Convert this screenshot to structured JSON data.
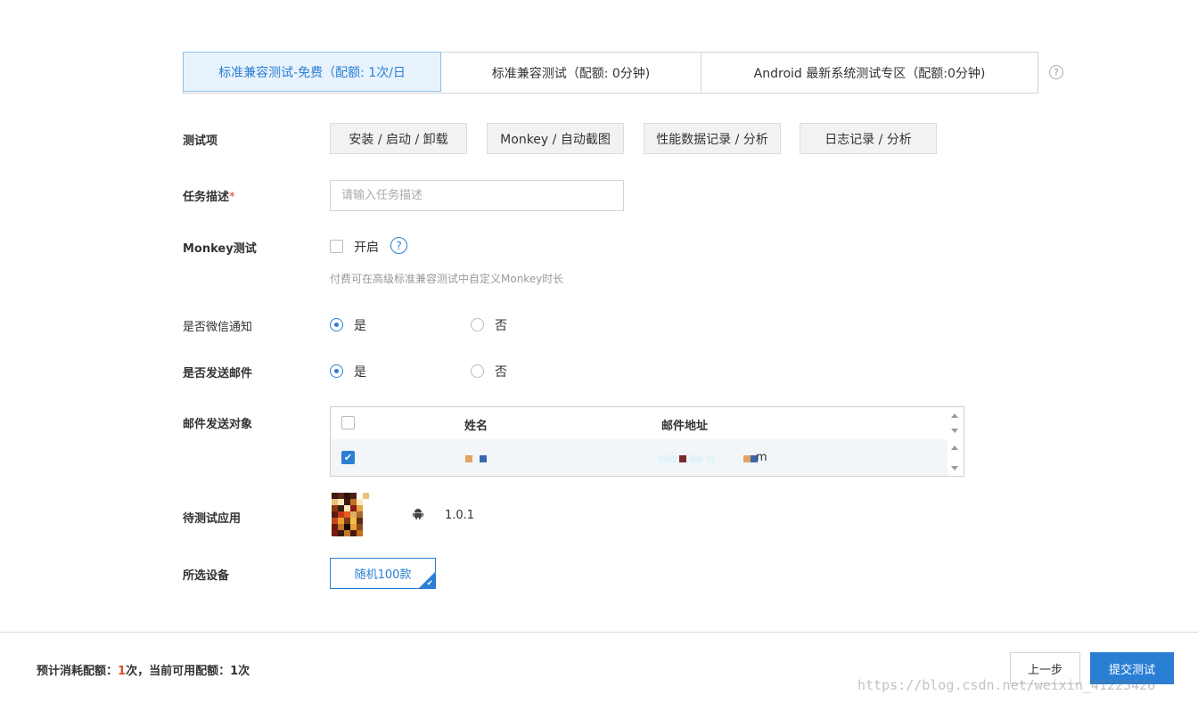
{
  "tabs": [
    {
      "label": "标准兼容测试-免费（配额: 1次/日",
      "active": true
    },
    {
      "label": "标准兼容测试（配额: 0分钟)",
      "active": false
    },
    {
      "label": "Android 最新系统测试专区（配额:0分钟)",
      "active": false
    }
  ],
  "help_icon": "?",
  "test_items": {
    "label": "测试项",
    "items": [
      "安装 / 启动 / 卸载",
      "Monkey / 自动截图",
      "性能数据记录 / 分析",
      "日志记录 / 分析"
    ]
  },
  "task_desc": {
    "label": "任务描述",
    "required_mark": "*",
    "placeholder": "请输入任务描述",
    "value": ""
  },
  "monkey": {
    "label": "Monkey测试",
    "toggle_label": "开启",
    "checked": false,
    "help_icon": "?",
    "hint": "付费可在高级标准兼容测试中自定义Monkey时长"
  },
  "wechat_notify": {
    "label": "是否微信通知",
    "options": [
      "是",
      "否"
    ],
    "selected": "是"
  },
  "send_email": {
    "label": "是否发送邮件",
    "options": [
      "是",
      "否"
    ],
    "selected": "是"
  },
  "mail_targets": {
    "label": "邮件发送对象",
    "columns": [
      "姓名",
      "邮件地址"
    ],
    "rows": [
      {
        "checked": true,
        "email_visible_suffix": "m"
      }
    ]
  },
  "app_under_test": {
    "label": "待测试应用",
    "platform_icon": "android-icon",
    "version": "1.0.1"
  },
  "devices": {
    "label": "所选设备",
    "selected": "随机100款",
    "check_mark": "✔"
  },
  "footer": {
    "quota_prefix": "预计消耗配额：",
    "consume": "1",
    "quota_mid": "次，当前可用配额：",
    "available": "1",
    "quota_suffix": "次",
    "prev_label": "上一步",
    "submit_label": "提交测试"
  },
  "watermark": "https://blog.csdn.net/weixin_41225426",
  "colors": {
    "accent": "#2a7fd4",
    "tab_active_bg": "#e8f3fd",
    "required": "#e03b3b",
    "quota_highlight": "#e04c2b"
  }
}
